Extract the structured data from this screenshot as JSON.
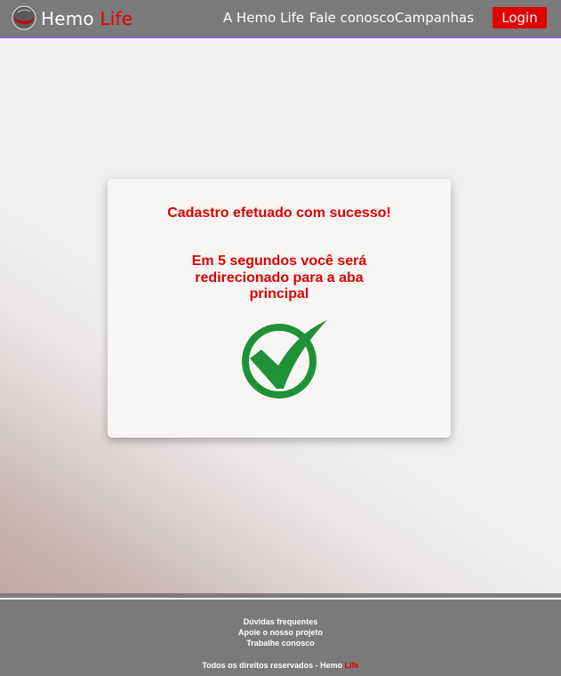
{
  "header": {
    "brand_first": "Hemo",
    "brand_second": "Life",
    "nav": [
      "A Hemo Life",
      "Fale conosco",
      "Campanhas"
    ],
    "login_label": "Login"
  },
  "card": {
    "title": "Cadastro efetuado com sucesso!",
    "message": "Em 5 segundos você será redirecionado para a aba principal",
    "icon": "check-circle-icon"
  },
  "footer": {
    "links": [
      "Dúvidas frequentes",
      "Apoie o nosso projeto",
      "Trabalhe conosco"
    ],
    "rights_prefix": "Todos os direitos reservados - Hemo ",
    "rights_brand": "Life"
  },
  "colors": {
    "accent_red": "#e00000",
    "header_gray": "#7a7a7a",
    "header_border": "#8a63d8",
    "check_green": "#1f9136"
  }
}
